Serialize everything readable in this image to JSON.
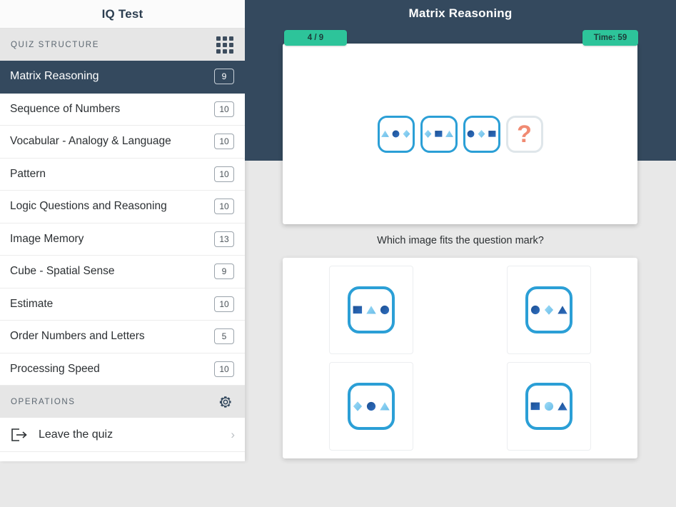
{
  "sidebar": {
    "title": "IQ Test",
    "structure_label": "QUIZ STRUCTURE",
    "grid_icon": "grid-icon",
    "items": [
      {
        "label": "Matrix Reasoning",
        "count": "9",
        "active": true
      },
      {
        "label": "Sequence of Numbers",
        "count": "10",
        "active": false
      },
      {
        "label": "Vocabular - Analogy & Language",
        "count": "10",
        "active": false
      },
      {
        "label": "Pattern",
        "count": "10",
        "active": false
      },
      {
        "label": "Logic Questions and Reasoning",
        "count": "10",
        "active": false
      },
      {
        "label": "Image Memory",
        "count": "13",
        "active": false
      },
      {
        "label": "Cube - Spatial Sense",
        "count": "9",
        "active": false
      },
      {
        "label": "Estimate",
        "count": "10",
        "active": false
      },
      {
        "label": "Order Numbers and Letters",
        "count": "5",
        "active": false
      },
      {
        "label": "Processing Speed",
        "count": "10",
        "active": false
      }
    ],
    "operations_label": "OPERATIONS",
    "gear_icon": "gear-icon",
    "leave_quiz": {
      "label": "Leave the quiz",
      "icon": "exit-icon",
      "chevron": "›"
    }
  },
  "main": {
    "title": "Matrix Reasoning",
    "progress": "4 / 9",
    "time": "Time: 59",
    "prompt": "Which image fits the question mark?",
    "question_mark": "?"
  },
  "colors": {
    "accent_teal": "#2dc49a",
    "navy": "#34495e",
    "tile_border": "#2b9fd6",
    "shape_dark": "#1c4f93",
    "shape_light": "#7fc9ef",
    "qmark": "#f08a72"
  },
  "sequence": [
    {
      "shapes": [
        "triangle-light",
        "circle-dark",
        "diamond-light"
      ]
    },
    {
      "shapes": [
        "diamond-light",
        "square-dark",
        "triangle-light"
      ]
    },
    {
      "shapes": [
        "circle-dark",
        "diamond-light",
        "square-dark"
      ]
    },
    {
      "shapes": [
        "question"
      ]
    }
  ],
  "answers": [
    {
      "option": "A",
      "shapes": [
        "square-dark",
        "triangle-light",
        "circle-dark"
      ]
    },
    {
      "option": "B",
      "shapes": [
        "circle-dark",
        "diamond-light",
        "triangle-dark"
      ]
    },
    {
      "option": "C",
      "shapes": [
        "diamond-light",
        "circle-dark",
        "triangle-light"
      ]
    },
    {
      "option": "D",
      "shapes": [
        "square-dark",
        "circle-light",
        "triangle-dark"
      ]
    }
  ]
}
